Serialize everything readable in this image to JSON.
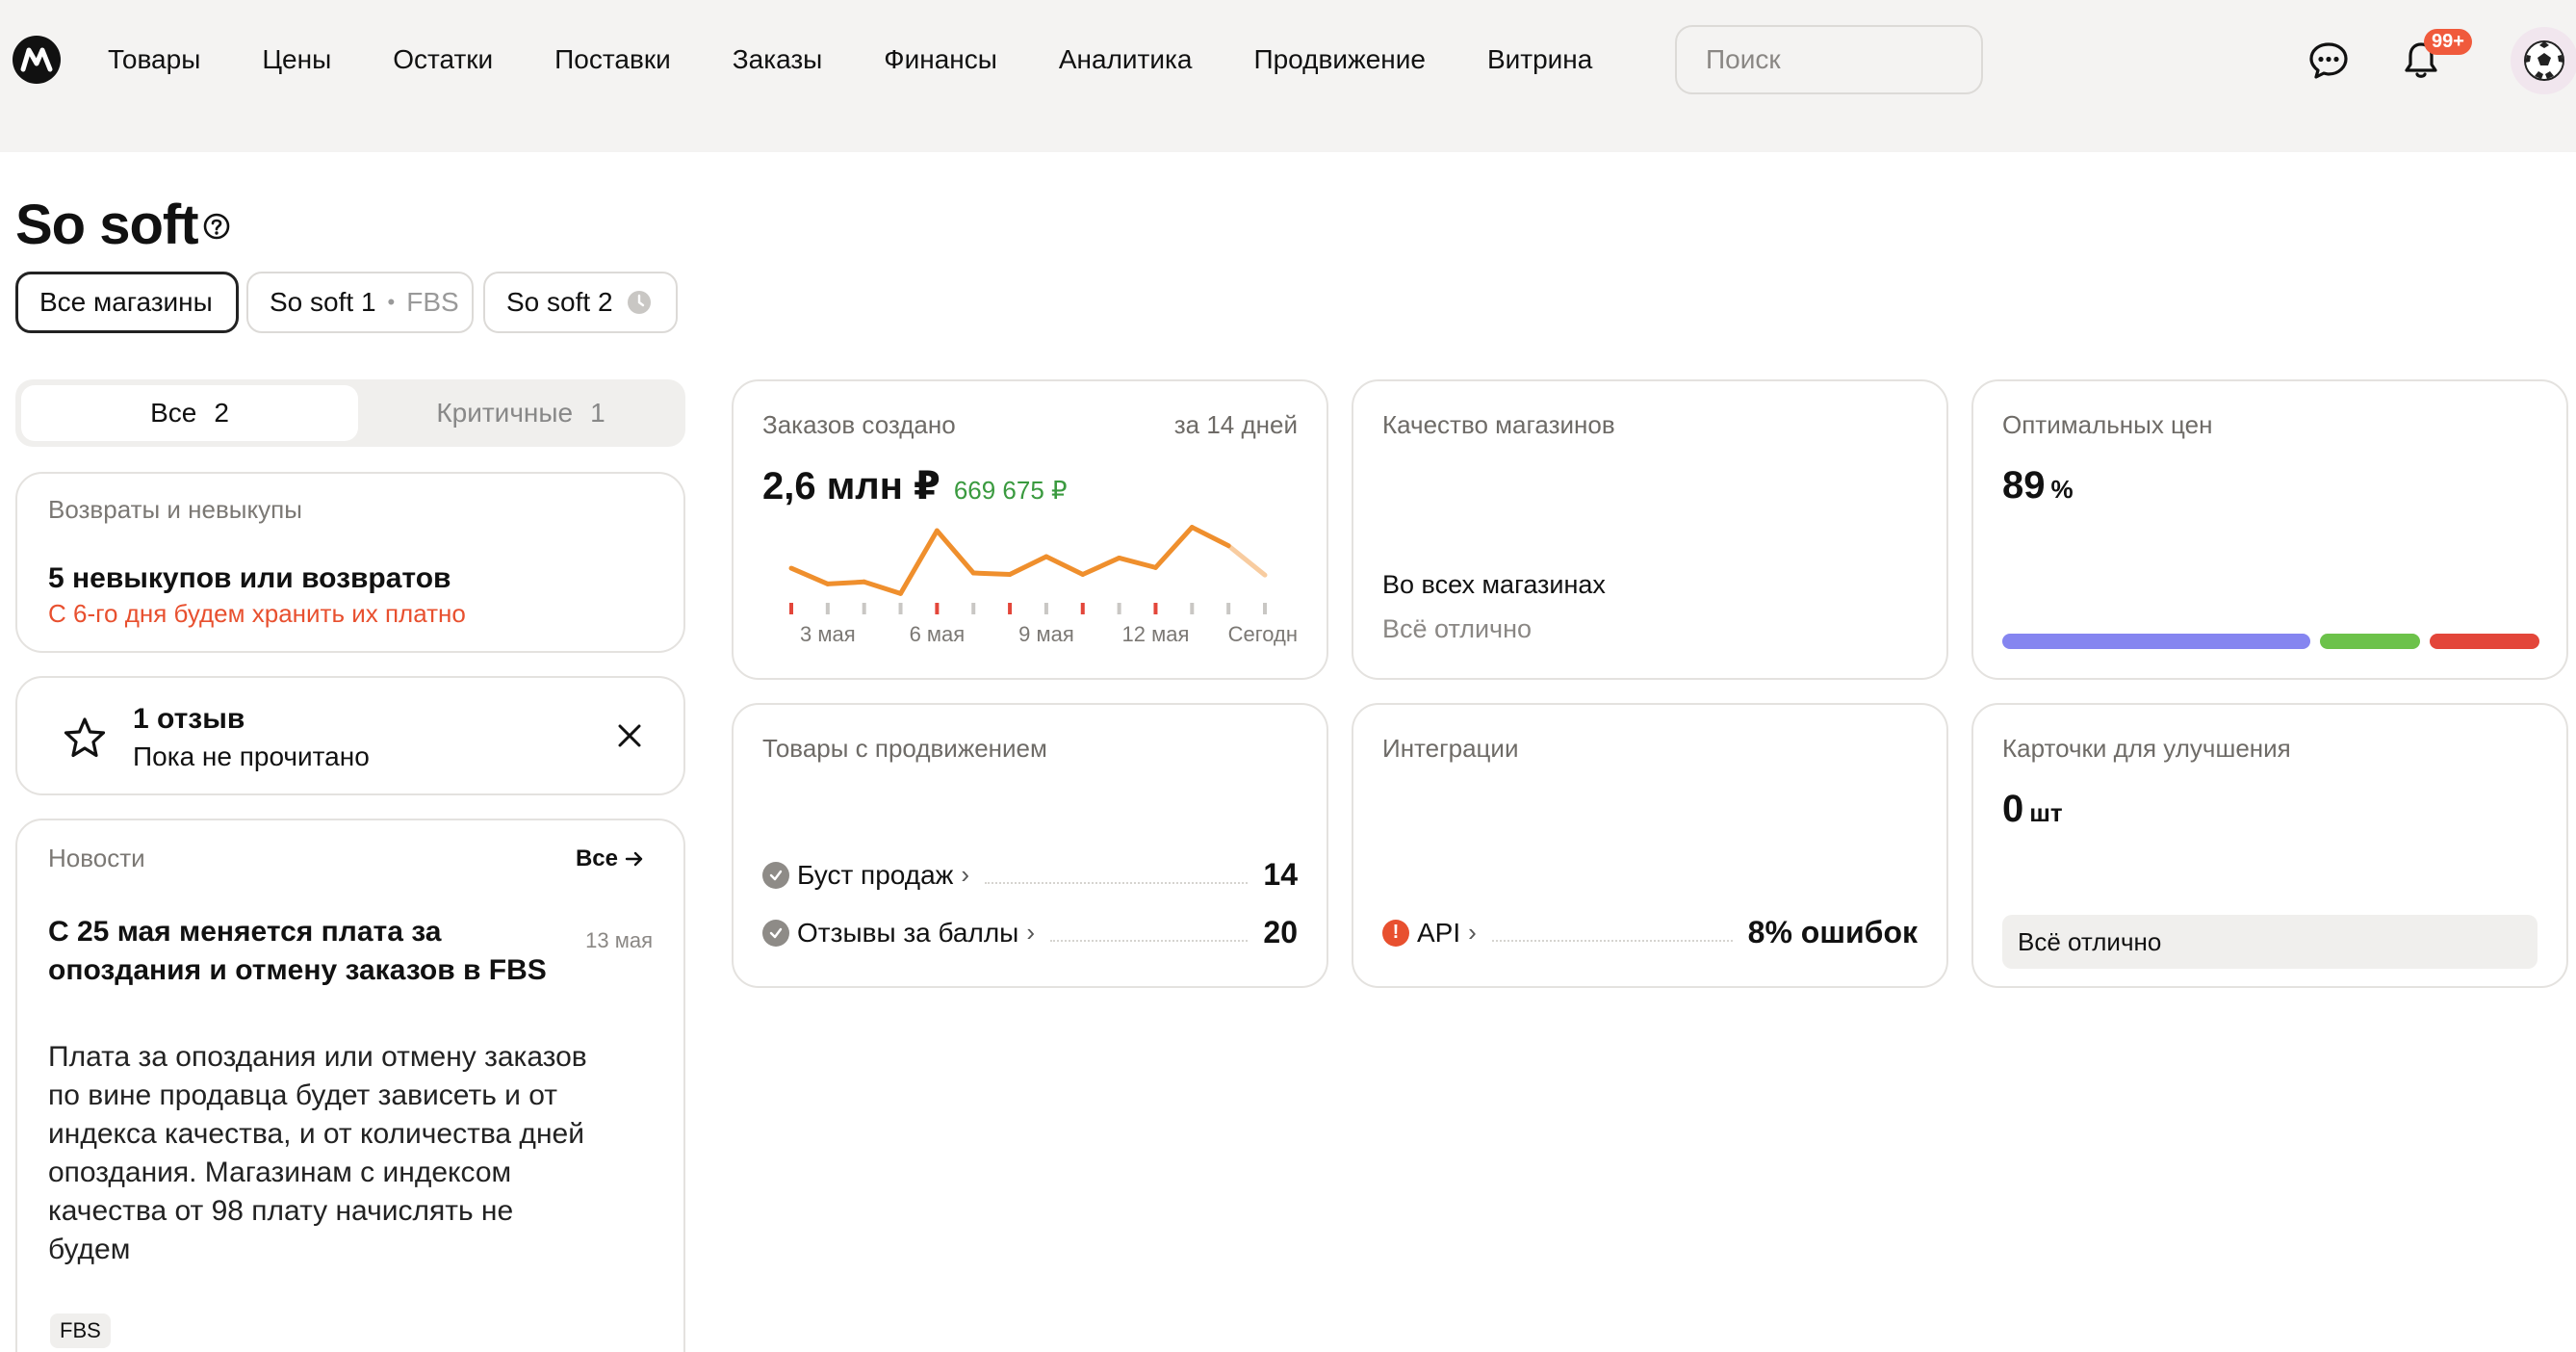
{
  "nav": {
    "items": [
      "Товары",
      "Цены",
      "Остатки",
      "Поставки",
      "Заказы",
      "Финансы",
      "Аналитика",
      "Продвижение",
      "Витрина"
    ],
    "search_placeholder": "Поиск",
    "notifications_badge": "99+"
  },
  "page": {
    "title": "So soft"
  },
  "stores": {
    "all": "Все магазины",
    "store1_name": "So soft 1",
    "store1_model": "FBS",
    "store2_name": "So soft 2"
  },
  "filter": {
    "all_label": "Все",
    "all_count": "2",
    "critical_label": "Критичные",
    "critical_count": "1"
  },
  "returns": {
    "header": "Возвраты и невыкупы",
    "title": "5 невыкупов или возвратов",
    "warning": "С 6-го дня будем хранить их платно"
  },
  "review": {
    "title": "1 отзыв",
    "subtitle": "Пока не прочитано"
  },
  "news": {
    "header": "Новости",
    "all_link": "Все",
    "date": "13 мая",
    "title": "С 25 мая меняется плата за опоздания и отмену заказов в FBS",
    "body": "Плата за опоздания или отмену заказов по вине продавца будет зависеть и от индекса качества, и от количества дней опоздания. Магазинам с индексом качества от 98 плату начислять не будем",
    "tag": "FBS"
  },
  "orders": {
    "label": "Заказов создано",
    "period": "за 14 дней",
    "value": "2,6 млн ₽",
    "secondary": "669 675 ₽"
  },
  "quality": {
    "label": "Качество магазинов",
    "line1": "Во всех магазинах",
    "line2": "Всё отлично"
  },
  "prices": {
    "label": "Оптимальных цен",
    "value": "89",
    "unit": "%",
    "bar_colors": [
      "#8585f0",
      "#6cc24a",
      "#e3463a"
    ]
  },
  "promo": {
    "label": "Товары с продвижением",
    "rows": [
      {
        "name": "Буст продаж",
        "value": "14"
      },
      {
        "name": "Отзывы за баллы",
        "value": "20"
      }
    ]
  },
  "integrations": {
    "label": "Интеграции",
    "api_name": "API",
    "api_value": "8% ошибок"
  },
  "cards": {
    "label": "Карточки для улучшения",
    "value": "0",
    "unit": "шт",
    "status": "Всё отлично"
  },
  "chart_data": {
    "type": "line",
    "title": "",
    "xlabel": "",
    "ylabel": "",
    "tick_labels": [
      "3 мая",
      "6 мая",
      "9 мая",
      "12 мая",
      "Сегодн"
    ],
    "x": [
      1,
      2,
      3,
      4,
      5,
      6,
      7,
      8,
      9,
      10,
      11,
      12,
      13,
      14
    ],
    "series": [
      {
        "values": [
          0.45,
          0.22,
          0.25,
          0.08,
          1.0,
          0.38,
          0.36,
          0.62,
          0.36,
          0.6,
          0.46,
          1.05,
          0.78,
          0.35
        ]
      }
    ],
    "marker_colors": [
      "#e3463a",
      "#c9c7c4",
      "#c9c7c4",
      "#c9c7c4",
      "#e3463a",
      "#c9c7c4",
      "#e3463a",
      "#c9c7c4",
      "#e3463a",
      "#c9c7c4",
      "#e3463a",
      "#c9c7c4",
      "#c9c7c4",
      "#c9c7c4"
    ],
    "line_color": "#ef8f2d",
    "grid": false,
    "legend": "none"
  }
}
